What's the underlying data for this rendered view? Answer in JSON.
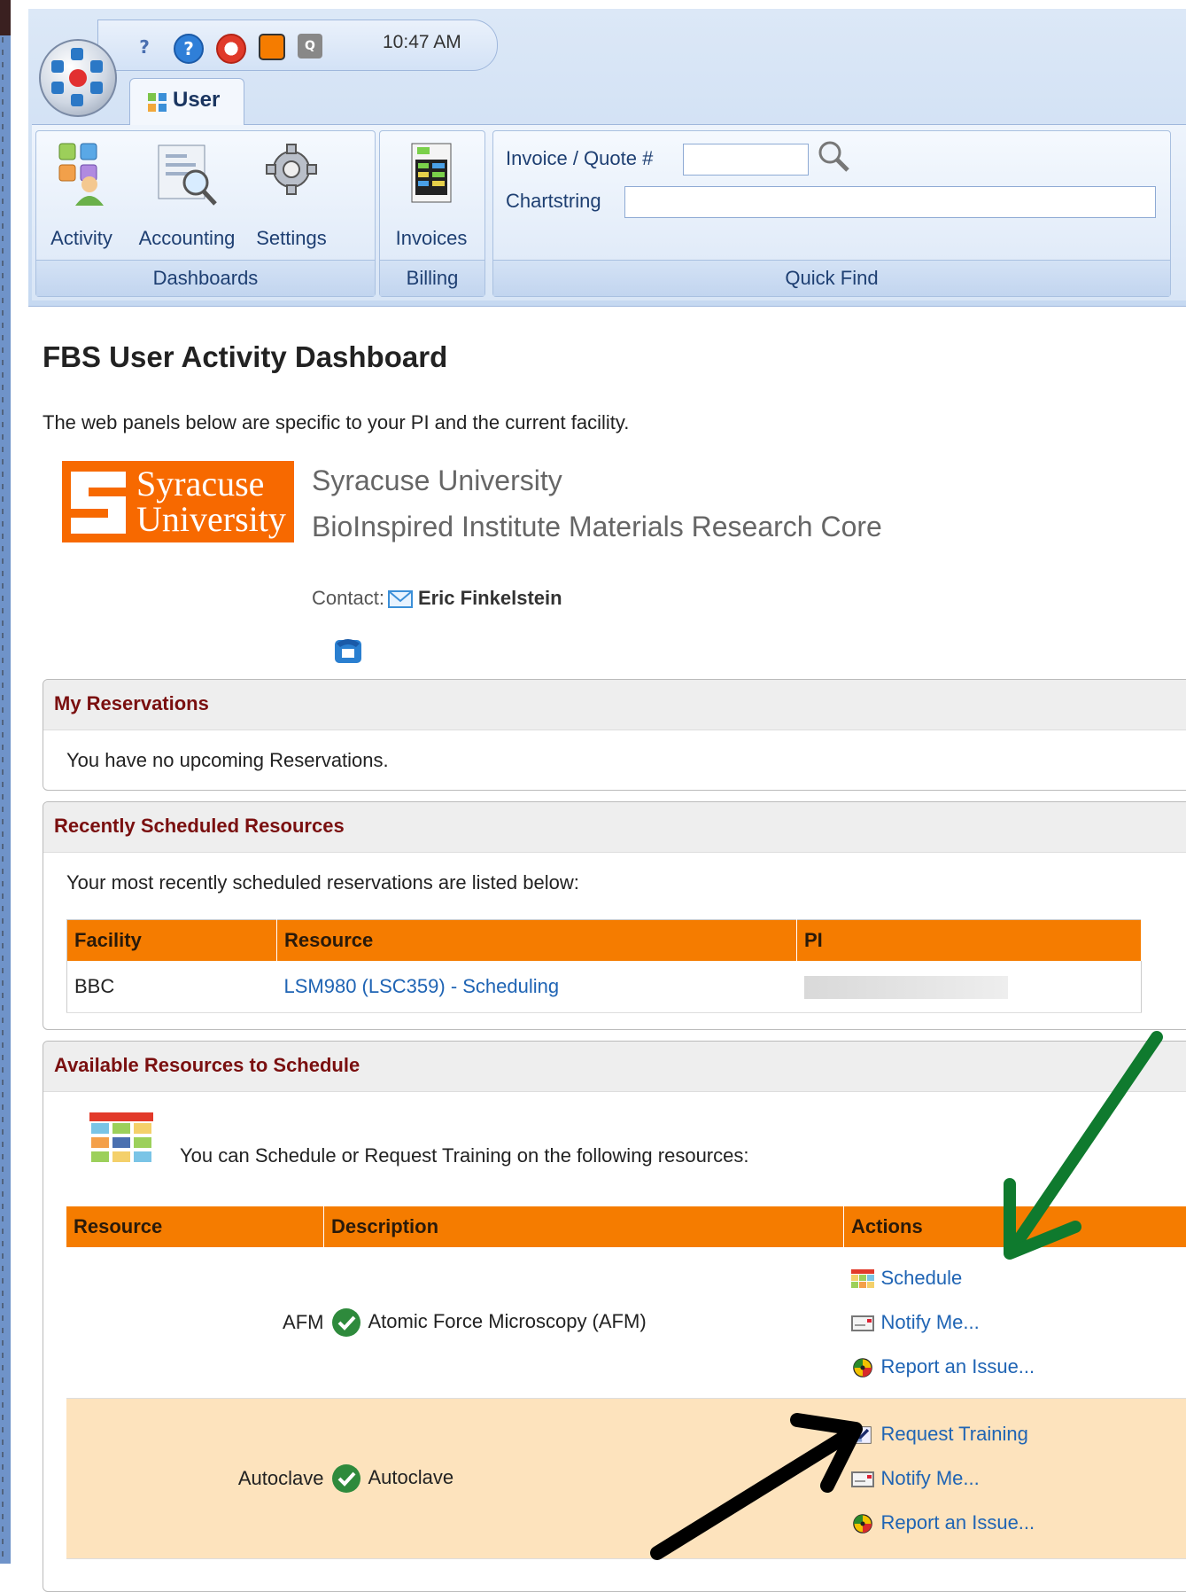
{
  "qat": {
    "time": "10:47 AM"
  },
  "ribbon": {
    "tab": "User",
    "groups": [
      {
        "label": "Dashboards",
        "buttons": [
          "Activity",
          "Accounting",
          "Settings"
        ]
      },
      {
        "label": "Billing",
        "buttons": [
          "Invoices"
        ]
      },
      {
        "label": "Quick Find"
      }
    ],
    "quickfind": {
      "invoice_label": "Invoice / Quote #",
      "chartstring_label": "Chartstring",
      "invoice_value": "",
      "chartstring_value": ""
    }
  },
  "page": {
    "title": "FBS User Activity Dashboard",
    "intro": "The web panels below are specific to your PI and the current facility.",
    "logo": {
      "line1": "Syracuse",
      "line2": "University"
    },
    "org_name": "Syracuse University",
    "core_name": "BioInspired Institute Materials Research Core",
    "contact_label": "Contact:",
    "contact_name": "Eric Finkelstein"
  },
  "reservations": {
    "title": "My Reservations",
    "empty": "You have no upcoming Reservations."
  },
  "recent": {
    "title": "Recently Scheduled Resources",
    "intro": "Your most recently scheduled reservations are listed below:",
    "columns": [
      "Facility",
      "Resource",
      "PI"
    ],
    "rows": [
      {
        "facility": "BBC",
        "resource": "LSM980 (LSC359) - Scheduling",
        "pi": ""
      }
    ]
  },
  "available": {
    "title": "Available Resources to Schedule",
    "intro": "You can Schedule or Request Training on the following resources:",
    "columns": [
      "Resource",
      "Description",
      "Actions"
    ],
    "rows": [
      {
        "resource": "AFM",
        "description": "Atomic Force Microscopy (AFM)",
        "actions": [
          "Schedule",
          "Notify Me...",
          "Report an Issue..."
        ]
      },
      {
        "resource": "Autoclave",
        "description": "Autoclave",
        "actions": [
          "Request Training",
          "Notify Me...",
          "Report an Issue..."
        ]
      }
    ]
  },
  "colors": {
    "accent": "#f57c00",
    "panel_title": "#7a0f0f",
    "link": "#1f64b4",
    "ribbon": "#c6d9f1",
    "arrow_green": "#0f7a2e",
    "arrow_black": "#000000"
  }
}
